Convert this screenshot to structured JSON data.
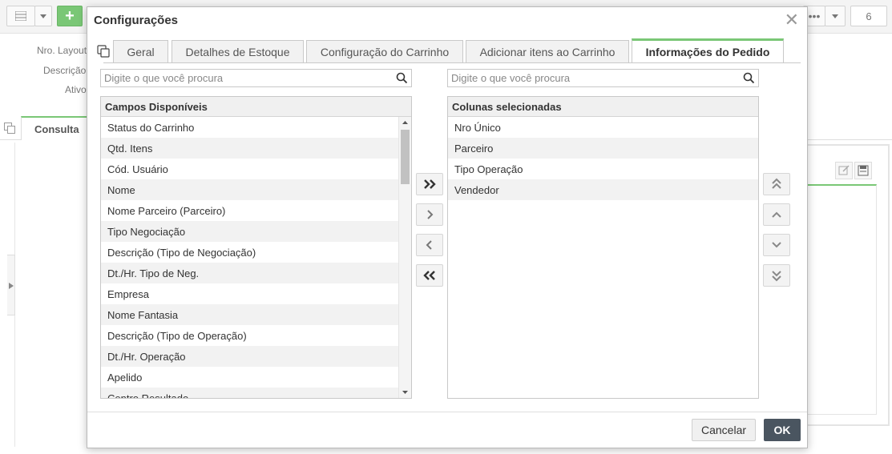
{
  "background": {
    "toolbar_number": "6",
    "labels": {
      "layout": "Nro. Layout",
      "description": "Descrição",
      "active": "Ativo"
    },
    "tab_label": "Consulta"
  },
  "dialog": {
    "title": "Configurações",
    "tabs": [
      {
        "label": "Geral"
      },
      {
        "label": "Detalhes de Estoque"
      },
      {
        "label": "Configuração do Carrinho"
      },
      {
        "label": "Adicionar itens ao Carrinho"
      },
      {
        "label": "Informações do Pedido",
        "active": true
      }
    ],
    "available": {
      "search_placeholder": "Digite o que você procura",
      "header": "Campos Disponíveis",
      "items": [
        "Status do Carrinho",
        "Qtd. Itens",
        "Cód. Usuário",
        "Nome",
        "Nome Parceiro (Parceiro)",
        "Tipo Negociação",
        "Descrição (Tipo de Negociação)",
        "Dt./Hr. Tipo de Neg.",
        "Empresa",
        "Nome Fantasia",
        "Descrição (Tipo de Operação)",
        "Dt./Hr. Operação",
        "Apelido",
        "Centro Resultado"
      ]
    },
    "selected": {
      "search_placeholder": "Digite o que você procura",
      "header": "Colunas selecionadas",
      "items": [
        "Nro Único",
        "Parceiro",
        "Tipo Operação",
        "Vendedor"
      ]
    },
    "buttons": {
      "cancel": "Cancelar",
      "ok": "OK"
    }
  },
  "colors": {
    "accent_green": "#7ac776",
    "ok_button": "#4a5560"
  }
}
